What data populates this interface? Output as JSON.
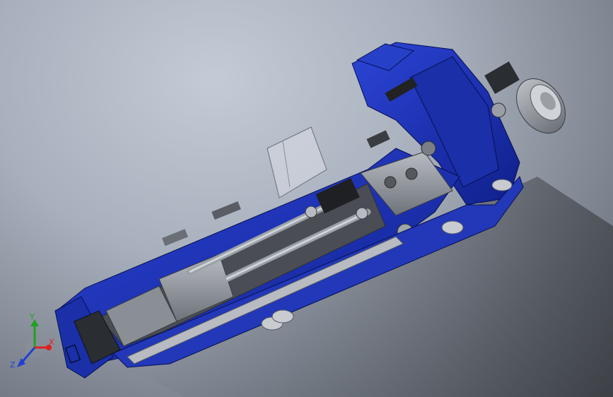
{
  "triad": {
    "x_label": "X",
    "y_label": "Y",
    "z_label": "Z",
    "x_color": "#e02020",
    "y_color": "#20a020",
    "z_color": "#2040d0"
  },
  "model": {
    "body_color": "#1a2fa8",
    "body_dark_color": "#0c1a6e",
    "grey_color": "#8a8f96",
    "dark_grey_color": "#3a3d42",
    "light_grey_color": "#c8ccd1",
    "glass_color": "#d8dde3"
  }
}
